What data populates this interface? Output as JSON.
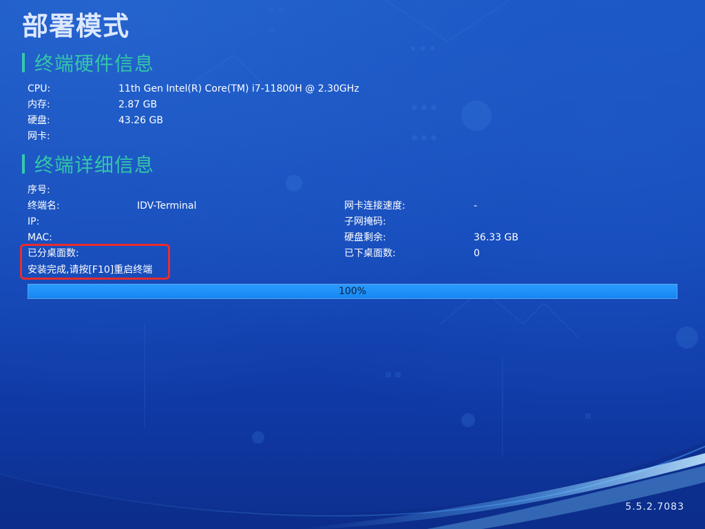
{
  "title": "部署模式",
  "hardware": {
    "section_title": "终端硬件信息",
    "rows": [
      {
        "label": "CPU:",
        "value": "11th Gen Intel(R) Core(TM) i7-11800H @ 2.30GHz"
      },
      {
        "label": "内存:",
        "value": "2.87 GB"
      },
      {
        "label": "硬盘:",
        "value": "43.26 GB"
      },
      {
        "label": "网卡:",
        "value": ""
      }
    ]
  },
  "details": {
    "section_title": "终端详细信息",
    "left": [
      {
        "label": "序号:",
        "value": ""
      },
      {
        "label": "终端名:",
        "value": "IDV-Terminal"
      },
      {
        "label": "IP:",
        "value": ""
      },
      {
        "label": "MAC:",
        "value": ""
      },
      {
        "label": "已分桌面数:",
        "value": ""
      }
    ],
    "right": [
      {
        "label": "网卡连接速度:",
        "value": "-"
      },
      {
        "label": "子网掩码:",
        "value": ""
      },
      {
        "label": "硬盘剩余:",
        "value": "36.33 GB"
      },
      {
        "label": "已下桌面数:",
        "value": "0"
      }
    ],
    "status_message": "安装完成,请按[F10]重启终端"
  },
  "progress": {
    "percent": 100,
    "label": "100%"
  },
  "version": "5.5.2.7083",
  "colors": {
    "accent": "#33c7a8",
    "highlight_border": "#ee2b2b",
    "progress_fill": "#1486f2",
    "background": "#1448b8"
  }
}
